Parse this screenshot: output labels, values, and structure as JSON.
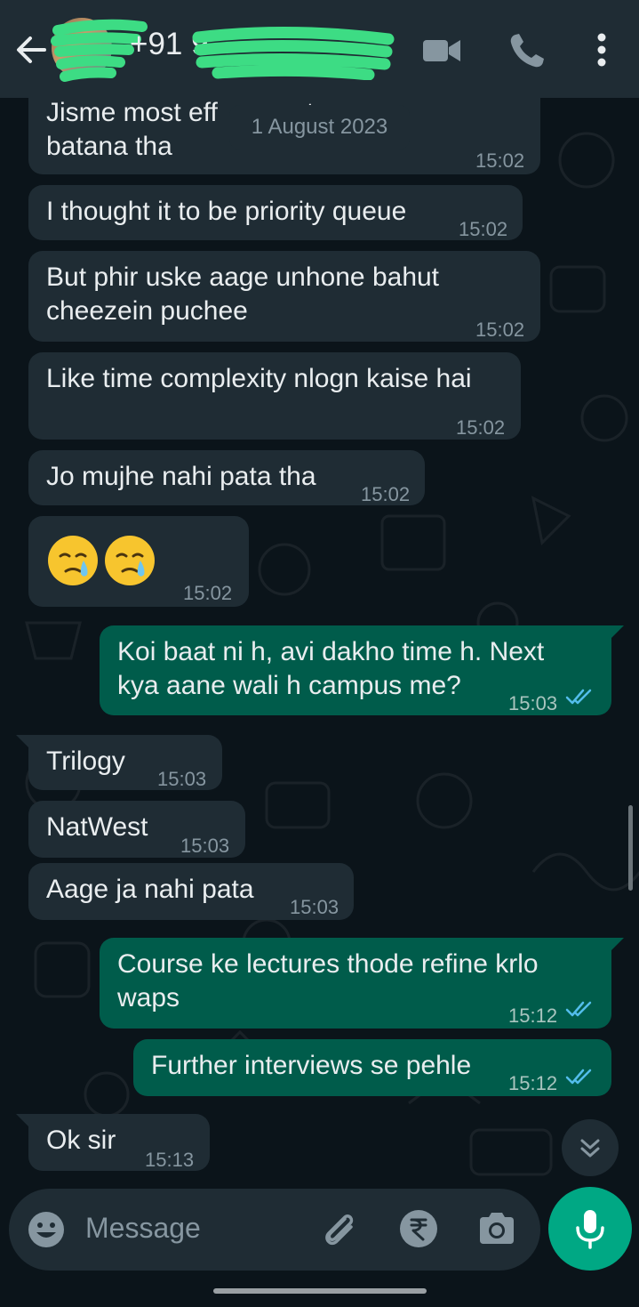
{
  "header": {
    "contact_number": "+91 9",
    "icons": [
      "back-arrow-icon",
      "video-call-icon",
      "voice-call-icon",
      "more-options-icon"
    ]
  },
  "date_chip": "1 August 2023",
  "messages": [
    {
      "dir": "in",
      "text": "Jisme most eff       ructure\nbatana tha",
      "time": "15:02"
    },
    {
      "dir": "in",
      "text": "I thought it to be priority queue",
      "time": "15:02"
    },
    {
      "dir": "in",
      "text": "But phir uske aage unhone bahut\ncheezein puchee",
      "time": "15:02"
    },
    {
      "dir": "in",
      "text": "Like time complexity nlogn kaise hai",
      "time": "15:02"
    },
    {
      "dir": "in",
      "text": "Jo mujhe nahi pata tha",
      "time": "15:02"
    },
    {
      "dir": "in",
      "text": "",
      "emoji": "crying-face-emoji",
      "time": "15:02"
    },
    {
      "dir": "out",
      "text": "Koi baat ni h, avi dakho time h. Next\nkya aane wali h campus me?",
      "time": "15:03",
      "status": "read"
    },
    {
      "dir": "in",
      "text": "Trilogy",
      "time": "15:03"
    },
    {
      "dir": "in",
      "text": "NatWest",
      "time": "15:03"
    },
    {
      "dir": "in",
      "text": "Aage ja nahi pata",
      "time": "15:03"
    },
    {
      "dir": "out",
      "text": "Course ke lectures thode refine krlo\nwaps",
      "time": "15:12",
      "status": "read"
    },
    {
      "dir": "out",
      "text": "Further interviews se pehle",
      "time": "15:12",
      "status": "read"
    },
    {
      "dir": "in",
      "text": "Ok sir",
      "time": "15:13"
    }
  ],
  "composer": {
    "placeholder": "Message",
    "icons": [
      "emoji-icon",
      "attach-icon",
      "rupee-payment-icon",
      "camera-icon",
      "microphone-icon"
    ]
  },
  "colors": {
    "background": "#0b141a",
    "header": "#1f2c34",
    "incoming_bubble": "#1f2c34",
    "outgoing_bubble": "#005c4b",
    "accent": "#00a884",
    "read_tick": "#53bdeb",
    "redaction": "#3ddc84"
  }
}
